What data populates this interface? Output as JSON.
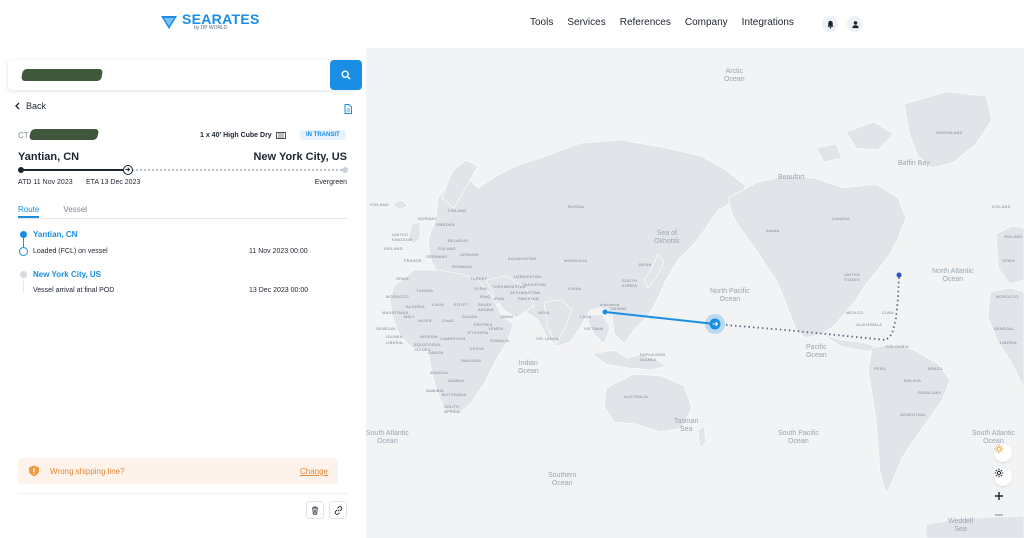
{
  "brand": {
    "name": "SEARATES",
    "sub": "by DP WORLD"
  },
  "nav": [
    "Tools",
    "Services",
    "References",
    "Company",
    "Integrations"
  ],
  "search": {
    "value": "",
    "placeholder": ""
  },
  "back_label": "Back",
  "shipment": {
    "ct_prefix": "CT",
    "container": "1 x 40' High Cube Dry",
    "status": "IN TRANSIT",
    "origin": "Yantian, CN",
    "destination": "New York City, US",
    "atd": "ATD 11 Nov 2023",
    "eta": "ETA 13 Dec 2023",
    "carrier": "Evergreen",
    "progress": 0.33
  },
  "tabs": [
    "Route",
    "Vessel"
  ],
  "route": [
    {
      "location": "Yantian, CN",
      "event": "Loaded (FCL) on vessel",
      "date": "11 Nov 2023 00:00"
    },
    {
      "location": "New York City, US",
      "event": "Vessel arrival at final POD",
      "date": "13 Dec 2023 00:00"
    }
  ],
  "warning": {
    "text": "Wrong shipping line?",
    "link": "Change"
  },
  "map": {
    "oceans": [
      "Arctic\nOcean",
      "North Pacific\nOcean",
      "Pacific\nOcean",
      "North Atlantic\nOcean",
      "Indian\nOcean",
      "Tasman\nSea",
      "South Pacific\nOcean",
      "South Atlantic\nOcean",
      "South Atlantic\nOcean",
      "Southern\nOcean",
      "Sea of\nOkhotsk",
      "Weddell\nSea",
      "Baffin Bay",
      "Beaufort"
    ],
    "countries": [
      "ICELAND",
      "NORWAY",
      "FINLAND",
      "SWEDEN",
      "UNITED\nKINGDOM",
      "BELARUS",
      "IRELAND",
      "POLAND",
      "UKRAINE",
      "FRANCE",
      "GERMANY",
      "SPAIN",
      "ROMANIA",
      "KAZAKHSTAN",
      "MONGOLIA",
      "RUSSIA",
      "UZBEKISTAN",
      "TURKEY",
      "TURKMENISTAN",
      "TAJIKISTAN",
      "AFGHANISTAN",
      "PAKISTAN",
      "IRAN",
      "IRAQ",
      "SYRIA",
      "MOROCCO",
      "TUNISIA",
      "ALGERIA",
      "LIBYA",
      "EGYPT",
      "SAUDI\nARABIA",
      "OMAN",
      "YEMEN",
      "INDIA",
      "CHINA",
      "SOUTH\nKOREA",
      "JAPAN",
      "TAIWAN",
      "LAOS",
      "VIETNAM",
      "SRI LANKA",
      "MAURITANIA",
      "MALI",
      "NIGER",
      "CHAD",
      "SUDAN",
      "ERITREA",
      "ETHIOPIA",
      "SOMALIA",
      "SENEGAL",
      "GUINEA",
      "LIBERIA",
      "NIGERIA",
      "CAMEROON",
      "EQUATORIAL\nGUINEA",
      "GABON",
      "KENYA",
      "TANZANIA",
      "ANGOLA",
      "ZAMBIA",
      "NAMIBIA",
      "BOTSWANA",
      "SOUTH\nAFRICA",
      "PAPUA NEW\nGUINEA",
      "AUSTRALIA",
      "CANADA",
      "Alaska",
      "UNITED\nSTATES",
      "MEXICO",
      "CUBA",
      "GUATEMALA",
      "COLOMBIA",
      "PERU",
      "BRAZIL",
      "BOLIVIA",
      "PARAGUAY",
      "ARGENTINA",
      "GREENLAND",
      "ICELAND",
      "IRELAND",
      "SPAIN",
      "MOROCCO",
      "SENEGAL",
      "LIBERIA",
      "Indonesia"
    ]
  },
  "colors": {
    "accent": "#1a8ee5",
    "warning": "#e2883a",
    "warning_bg": "#fdf3ea",
    "land": "#e1e5ea",
    "sea": "#f1f3f5"
  }
}
